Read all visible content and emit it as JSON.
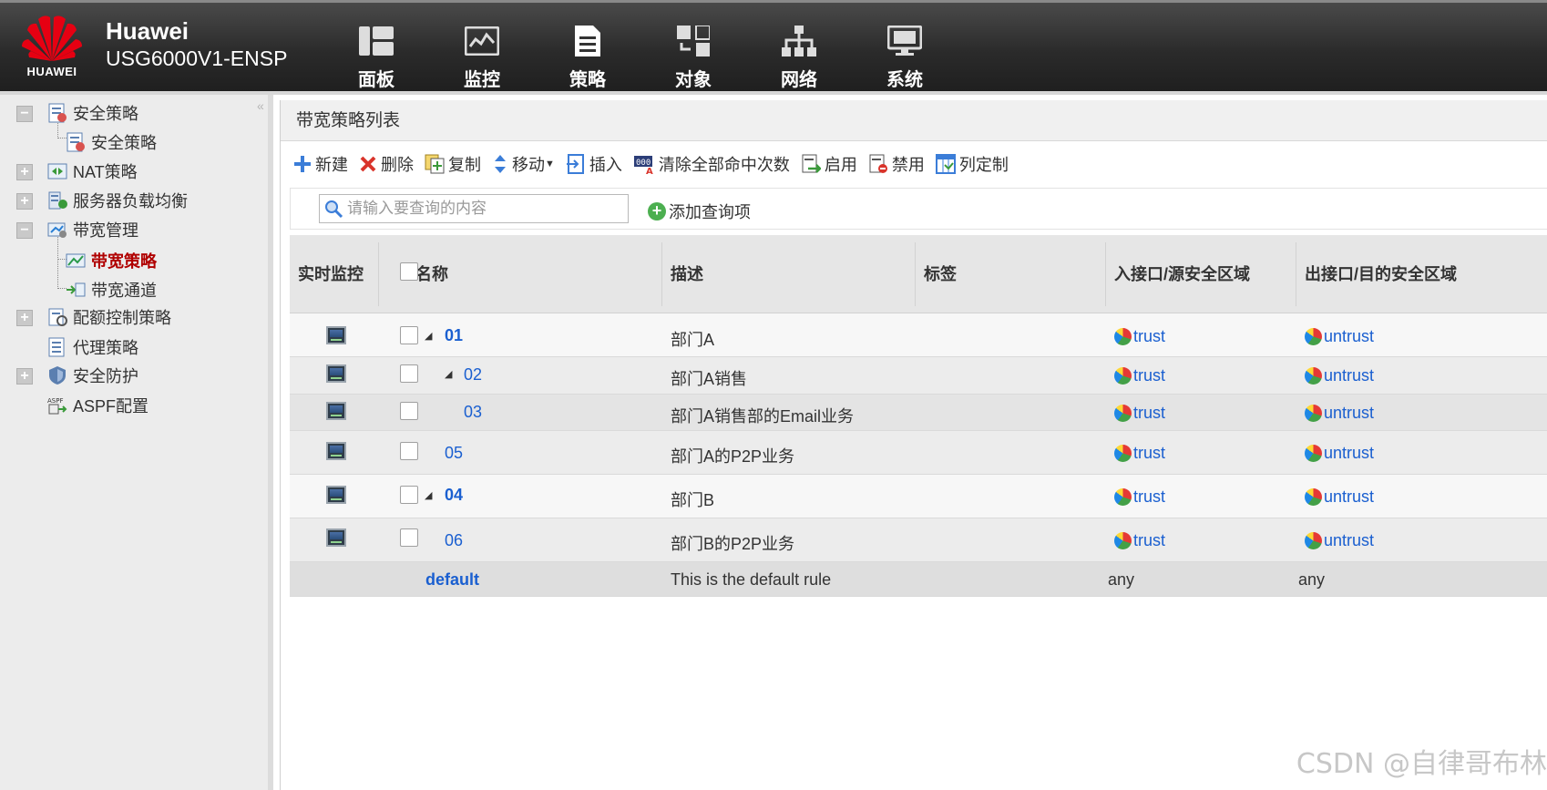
{
  "header": {
    "logo_text": "HUAWEI",
    "brand_name": "Huawei",
    "model": "USG6000V1-ENSP",
    "nav": [
      {
        "label": "面板",
        "icon": "dashboard-icon"
      },
      {
        "label": "监控",
        "icon": "monitor-icon"
      },
      {
        "label": "策略",
        "icon": "policy-icon"
      },
      {
        "label": "对象",
        "icon": "object-icon"
      },
      {
        "label": "网络",
        "icon": "network-icon"
      },
      {
        "label": "系统",
        "icon": "system-icon"
      }
    ]
  },
  "sidebar": {
    "items": [
      {
        "label": "安全策略",
        "expanded": true
      },
      {
        "label": "安全策略"
      },
      {
        "label": "NAT策略",
        "expanded": false
      },
      {
        "label": "服务器负载均衡",
        "expanded": false
      },
      {
        "label": "带宽管理",
        "expanded": true
      },
      {
        "label": "带宽策略",
        "active": true
      },
      {
        "label": "带宽通道"
      },
      {
        "label": "配额控制策略",
        "expanded": false
      },
      {
        "label": "代理策略"
      },
      {
        "label": "安全防护",
        "expanded": false
      },
      {
        "label": "ASPF配置"
      }
    ]
  },
  "main": {
    "title": "带宽策略列表",
    "toolbar": {
      "new": "新建",
      "delete": "删除",
      "copy": "复制",
      "move": "移动",
      "insert": "插入",
      "clear_hits": "清除全部命中次数",
      "enable": "启用",
      "disable": "禁用",
      "customize": "列定制"
    },
    "search": {
      "placeholder": "请输入要查询的内容",
      "add_query": "添加查询项"
    },
    "table": {
      "columns": [
        "实时监控",
        "名称",
        "描述",
        "标签",
        "入接口/源安全区域",
        "出接口/目的安全区域"
      ],
      "rows": [
        {
          "name": "01",
          "level": 0,
          "expandable": true,
          "desc": "部门A",
          "src": "trust",
          "dst": "untrust"
        },
        {
          "name": "02",
          "level": 1,
          "expandable": true,
          "desc": "部门A销售",
          "src": "trust",
          "dst": "untrust"
        },
        {
          "name": "03",
          "level": 2,
          "expandable": false,
          "desc": "部门A销售部的Email业务",
          "src": "trust",
          "dst": "untrust"
        },
        {
          "name": "05",
          "level": 1,
          "expandable": false,
          "desc": "部门A的P2P业务",
          "src": "trust",
          "dst": "untrust"
        },
        {
          "name": "04",
          "level": 0,
          "expandable": true,
          "desc": "部门B",
          "src": "trust",
          "dst": "untrust"
        },
        {
          "name": "06",
          "level": 1,
          "expandable": false,
          "desc": "部门B的P2P业务",
          "src": "trust",
          "dst": "untrust"
        }
      ],
      "default_row": {
        "name": "default",
        "desc": "This is the default rule",
        "src": "any",
        "dst": "any"
      }
    }
  },
  "watermark": "CSDN @自律哥布林"
}
